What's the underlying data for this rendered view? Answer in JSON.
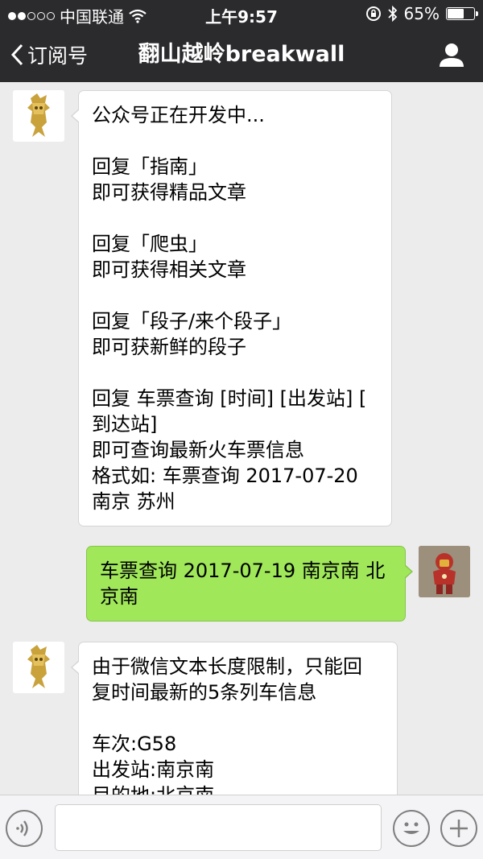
{
  "status_bar": {
    "carrier": "中国联通",
    "time": "上午9:57",
    "battery_text": "65%",
    "battery_level": 0.65
  },
  "nav": {
    "back_label": "订阅号",
    "title": "翻山越岭breakwall"
  },
  "messages": [
    {
      "from": "bot",
      "text": "公众号正在开发中...\n\n回复「指南」\n即可获得精品文章\n\n回复「爬虫」\n即可获得相关文章\n\n回复「段子/来个段子」\n即可获新鲜的段子\n\n回复 车票查询 [时间] [出发站] [\n到达站]\n即可查询最新火车票信息\n格式如: 车票查询 2017-07-20\n南京 苏州"
    },
    {
      "from": "user",
      "text": "车票查询 2017-07-19 南京南 北\n京南"
    },
    {
      "from": "bot",
      "text": "由于微信文本长度限制，只能回\n复时间最新的5条列车信息\n\n车次:G58\n出发站:南京南\n目的地:北京南"
    }
  ],
  "colors": {
    "bar_bg": "#2b2b2e",
    "chat_bg": "#ececec",
    "out_bubble": "#a0e75a",
    "in_bubble": "#ffffff"
  },
  "icons": {
    "back": "chevron-left-icon",
    "profile": "person-icon",
    "voice": "voice-icon",
    "emoji": "emoji-icon",
    "more": "plus-icon"
  }
}
